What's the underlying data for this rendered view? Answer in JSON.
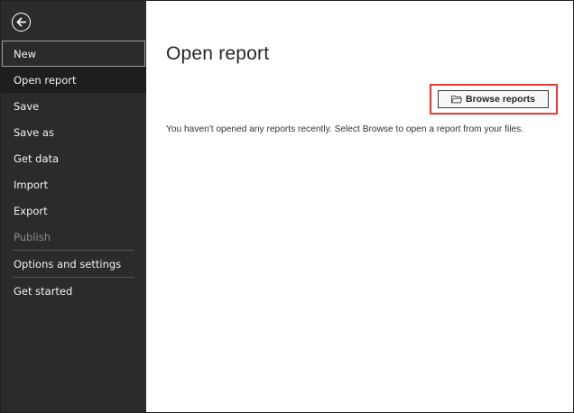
{
  "sidebar": {
    "back_icon": "arrow-left-circle-icon",
    "items": [
      {
        "label": "New"
      },
      {
        "label": "Open report"
      },
      {
        "label": "Save"
      },
      {
        "label": "Save as"
      },
      {
        "label": "Get data"
      },
      {
        "label": "Import"
      },
      {
        "label": "Export"
      },
      {
        "label": "Publish"
      },
      {
        "label": "Options and settings"
      },
      {
        "label": "Get started"
      }
    ],
    "selected": "Open report",
    "disabled": [
      "Publish"
    ]
  },
  "main": {
    "title": "Open report",
    "browse_button": {
      "label": "Browse reports",
      "icon": "folder-open-icon"
    },
    "empty_message": "You haven't opened any reports recently. Select Browse to open a report from your files."
  },
  "colors": {
    "sidebar_bg": "#2b2b2b",
    "selected_bg": "#1e1e1e",
    "highlight": "#e53935"
  }
}
